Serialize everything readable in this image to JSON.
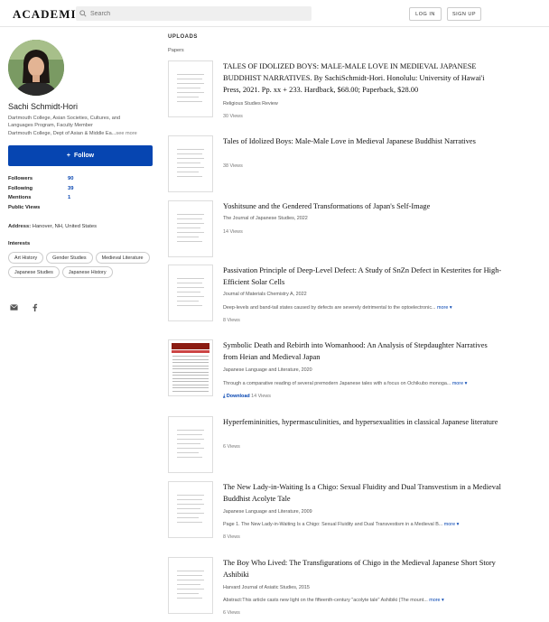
{
  "header": {
    "logo": "ACADEMIA",
    "search_placeholder": "Search",
    "login_label": "LOG IN",
    "signup_label": "SIGN UP"
  },
  "profile": {
    "name": "Sachi Schmidt-Hori",
    "affiliation_1": "Dartmouth College, Asian Societies, Cultures, and Languages Program, Faculty Member",
    "affiliation_2": "Dartmouth College, Dept of Asian & Middle Ea...",
    "see_more": "see more",
    "follow_label": "Follow",
    "stats": [
      {
        "label": "Followers",
        "value": "90"
      },
      {
        "label": "Following",
        "value": "39"
      },
      {
        "label": "Mentions",
        "value": "1"
      },
      {
        "label": "Public Views",
        "value": ""
      }
    ],
    "address_label": "Address:",
    "address_value": "Hanover, NH, United States",
    "interests_heading": "Interests",
    "interests": [
      "Art History",
      "Gender Studies",
      "Medieval Literature",
      "Japanese Studies",
      "Japanese History"
    ]
  },
  "main": {
    "uploads_heading": "UPLOADS",
    "papers_heading": "Papers",
    "papers": [
      {
        "title": "TALES OF IDOLIZED BOYS: MALE-MALE LOVE IN MEDIEVAL JAPANESE BUDDHIST NARRATIVES. By SachiSchmidt-Hori. Honolulu: University of Hawai'i Press, 2021. Pp. xx + 233. Hardback, $68.00; Paperback, $28.00",
        "meta": "Religious Studies Review",
        "abstract": "",
        "more": "",
        "download": "",
        "views": "30 Views"
      },
      {
        "title": "Tales of Idolized Boys: Male-Male Love in Medieval Japanese Buddhist Narratives",
        "meta": "",
        "abstract": "",
        "more": "",
        "download": "",
        "views": "38 Views"
      },
      {
        "title": "Yoshitsune and the Gendered Transformations of Japan's Self-Image",
        "meta": "The Journal of Japanese Studies, 2022",
        "abstract": "",
        "more": "",
        "download": "",
        "views": "14 Views"
      },
      {
        "title": "Passivation Principle of Deep-Level Defect: A Study of SnZn Defect in Kesterites for High-Efficient Solar Cells",
        "meta": "Journal of Materials Chemistry A, 2022",
        "abstract": "Deep-levels and band-tail states caused by defects are severely detrimental to the optoelectronic...",
        "more": "more",
        "download": "",
        "views": "8 Views"
      },
      {
        "title": "Symbolic Death and Rebirth into Womanhood: An Analysis of Stepdaughter Narratives from Heian and Medieval Japan",
        "meta": "Japanese Language and Literature, 2020",
        "abstract": "Through a comparative reading of several premodern Japanese tales with a focus on Ochikubo monoga...",
        "more": "more",
        "download": "Download",
        "views": "14 Views"
      },
      {
        "title": "Hyperfemininities, hypermasculinities, and hypersexualities in classical Japanese literature",
        "meta": "",
        "abstract": "",
        "more": "",
        "download": "",
        "views": "6 Views"
      },
      {
        "title": "The New Lady-in-Waiting Is a Chigo: Sexual Fluidity and Dual Transvestism in a Medieval Buddhist Acolyte Tale",
        "meta": "Japanese Language and Literature, 2009",
        "abstract": "Page 1. The New Lady-in-Waiting Is a Chigo: Sexual Fluidity and Dual Transvestism in a Medieval B...",
        "more": "more",
        "download": "",
        "views": "8 Views"
      },
      {
        "title": "The Boy Who Lived: The Transfigurations of Chigo in the Medieval Japanese Short Story Ashibiki",
        "meta": "Harvard Journal of Asiatic Studies, 2015",
        "abstract": "Abstract:This article casts new light on the fifteenth-century \"acolyte tale\" Ashibiki (The mount...",
        "more": "more",
        "download": "",
        "views": "6 Views"
      }
    ]
  }
}
